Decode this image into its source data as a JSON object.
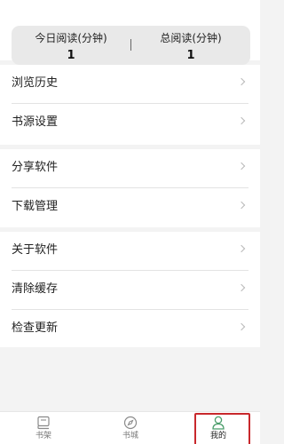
{
  "stats": {
    "today_label": "今日阅读(分钟)",
    "today_value": "1",
    "total_label": "总阅读(分钟)",
    "total_value": "1"
  },
  "menu": {
    "group1": [
      {
        "label": "浏览历史"
      },
      {
        "label": "书源设置"
      }
    ],
    "group2": [
      {
        "label": "分享软件"
      },
      {
        "label": "下载管理"
      }
    ],
    "group3": [
      {
        "label": "关于软件"
      },
      {
        "label": "清除缓存"
      },
      {
        "label": "检查更新"
      }
    ]
  },
  "tabbar": {
    "items": [
      {
        "label": "书架",
        "icon": "book-icon"
      },
      {
        "label": "书城",
        "icon": "compass-icon"
      },
      {
        "label": "我的",
        "icon": "person-icon",
        "active": true
      }
    ]
  },
  "colors": {
    "accent": "#c8282c"
  }
}
